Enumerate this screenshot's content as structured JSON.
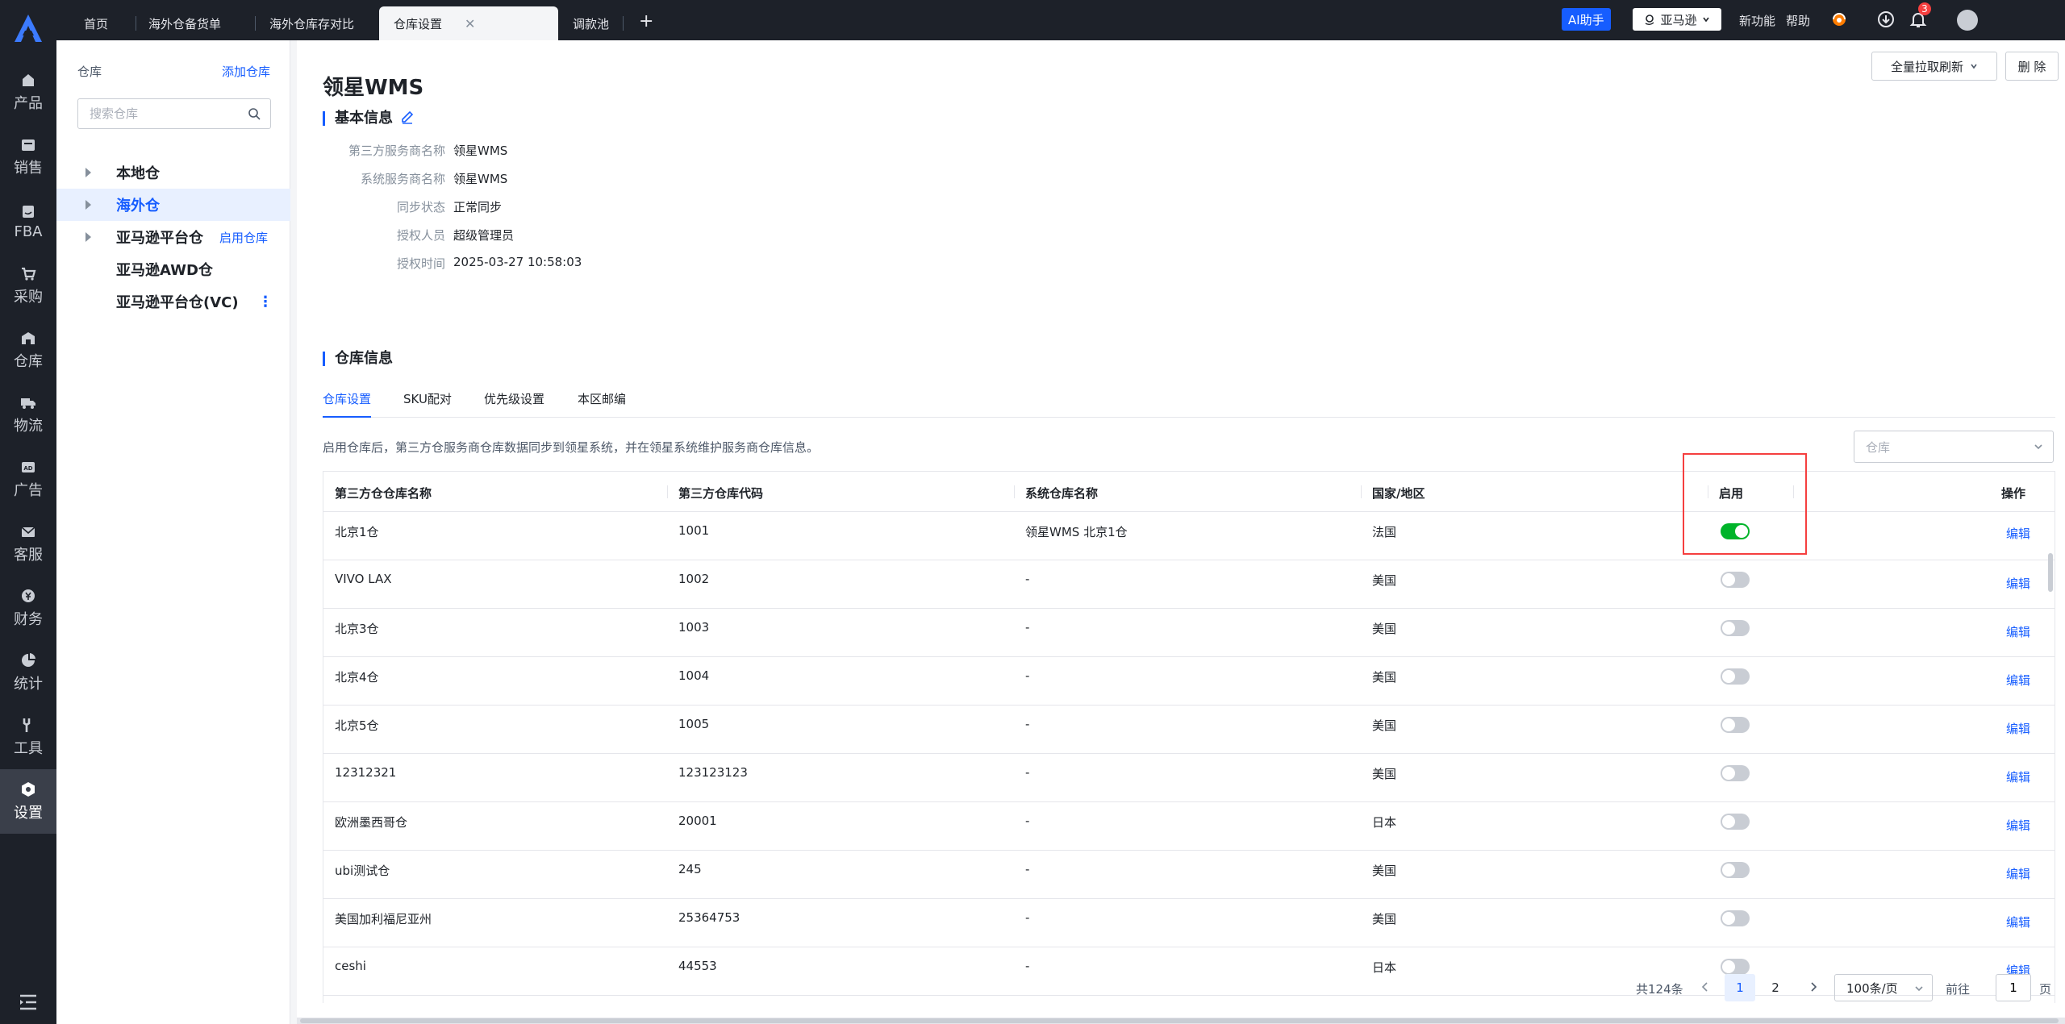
{
  "nav": {
    "items": [
      {
        "label": "产品",
        "icon": "product-icon"
      },
      {
        "label": "销售",
        "icon": "sales-icon"
      },
      {
        "label": "FBA",
        "icon": "fba-icon"
      },
      {
        "label": "采购",
        "icon": "cart-icon"
      },
      {
        "label": "仓库",
        "icon": "warehouse-icon"
      },
      {
        "label": "物流",
        "icon": "truck-icon"
      },
      {
        "label": "广告",
        "icon": "ad-icon"
      },
      {
        "label": "客服",
        "icon": "mail-icon"
      },
      {
        "label": "财务",
        "icon": "finance-icon"
      },
      {
        "label": "统计",
        "icon": "pie-chart-icon"
      },
      {
        "label": "工具",
        "icon": "tool-icon"
      },
      {
        "label": "设置",
        "icon": "settings-icon"
      }
    ],
    "active_index": 11
  },
  "tabs": [
    {
      "label": "首页"
    },
    {
      "label": "海外仓备货单"
    },
    {
      "label": "海外仓库存对比"
    },
    {
      "label": "仓库设置",
      "active": true,
      "close": "✕"
    },
    {
      "label": "调款池"
    }
  ],
  "topbar": {
    "ai_label": "AI助手",
    "site_label": "亚马逊",
    "new_feature": "新功能",
    "help": "帮助",
    "notification_count": "3"
  },
  "tree": {
    "header": "仓库",
    "add_label": "添加仓库",
    "search_placeholder": "搜索仓库",
    "nodes": [
      {
        "label": "本地仓",
        "expandable": true
      },
      {
        "label": "海外仓",
        "expandable": true,
        "selected": true
      },
      {
        "label": "亚马逊平台仓",
        "expandable": true,
        "action": "启用仓库"
      },
      {
        "label": "亚马逊AWD仓",
        "expandable": false
      },
      {
        "label": "亚马逊平台仓(VC)",
        "expandable": false,
        "more": "⋮"
      }
    ]
  },
  "main": {
    "refresh_label": "全量拉取刷新",
    "delete_label": "删 除",
    "title": "领星WMS",
    "basic_title": "基本信息",
    "basic_info": [
      {
        "key": "第三方服务商名称",
        "value": "领星WMS"
      },
      {
        "key": "系统服务商名称",
        "value": "领星WMS"
      },
      {
        "key": "同步状态",
        "value": "正常同步"
      },
      {
        "key": "授权人员",
        "value": "超级管理员"
      },
      {
        "key": "授权时间",
        "value": "2025-03-27 10:58:03"
      }
    ],
    "warehouse_title": "仓库信息",
    "sub_tabs": [
      "仓库设置",
      "SKU配对",
      "优先级设置",
      "本区邮编"
    ],
    "hint": "启用仓库后，第三方仓服务商仓库数据同步到领星系统，并在领星系统维护服务商仓库信息。",
    "select_placeholder": "仓库"
  },
  "table": {
    "columns": [
      "第三方仓仓库名称",
      "第三方仓库代码",
      "系统仓库名称",
      "国家/地区",
      "启用",
      "操作"
    ],
    "action_label": "编辑",
    "rows": [
      {
        "name": "北京1仓",
        "code": "1001",
        "system": "领星WMS 北京1仓",
        "country": "法国",
        "enabled": true
      },
      {
        "name": "VIVO LAX",
        "code": "1002",
        "system": "-",
        "country": "美国",
        "enabled": false
      },
      {
        "name": "北京3仓",
        "code": "1003",
        "system": "-",
        "country": "美国",
        "enabled": false
      },
      {
        "name": "北京4仓",
        "code": "1004",
        "system": "-",
        "country": "美国",
        "enabled": false
      },
      {
        "name": "北京5仓",
        "code": "1005",
        "system": "-",
        "country": "美国",
        "enabled": false
      },
      {
        "name": "12312321",
        "code": "123123123",
        "system": "-",
        "country": "美国",
        "enabled": false
      },
      {
        "name": "欧洲墨西哥仓",
        "code": "20001",
        "system": "-",
        "country": "日本",
        "enabled": false
      },
      {
        "name": "ubi测试仓",
        "code": "245",
        "system": "-",
        "country": "美国",
        "enabled": false
      },
      {
        "name": "美国加利福尼亚州",
        "code": "25364753",
        "system": "-",
        "country": "美国",
        "enabled": false
      },
      {
        "name": "ceshi",
        "code": "44553",
        "system": "-",
        "country": "日本",
        "enabled": false
      }
    ]
  },
  "pagination": {
    "total": "共124条",
    "pages": [
      "1",
      "2"
    ],
    "current": "1",
    "page_size": "100条/页",
    "goto_label": "前往",
    "goto_value": "1",
    "page_suffix": "页"
  },
  "colors": {
    "accent": "#165dff",
    "switch_on": "#00b42a",
    "highlight": "#f53f3f",
    "nav_bg": "#1d2129"
  }
}
